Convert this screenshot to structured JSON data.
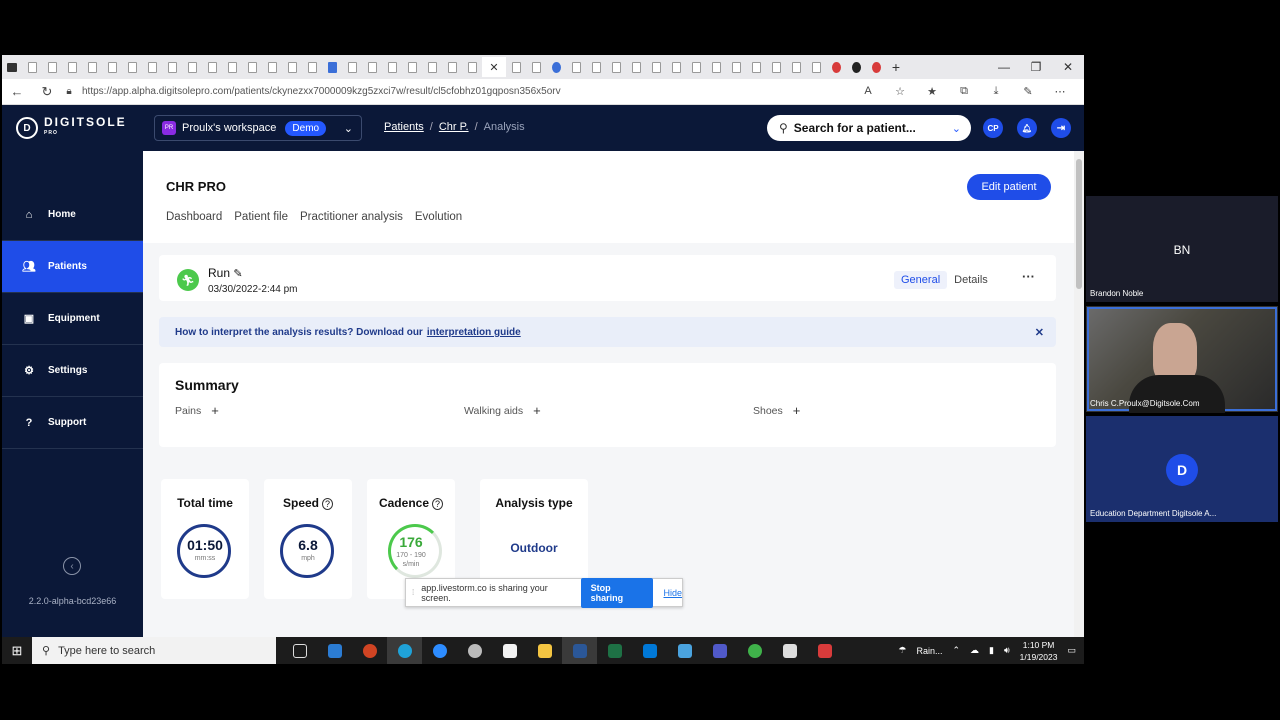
{
  "browser": {
    "url": "https://app.alpha.digitsolepro.com/patients/ckynezxx7000009kzg5zxci7w/result/cl5cfobhz01gqposn356x5orv"
  },
  "topnav": {
    "logo_text": "DIGITSOLE",
    "logo_sub": "PRO",
    "workspace_badge": "PR",
    "workspace_name": "Proulx's workspace",
    "workspace_tag": "Demo",
    "breadcrumbs": [
      "Patients",
      "Chr P.",
      "Analysis"
    ],
    "search_placeholder": "Search for a patient...",
    "user_initials": "CP"
  },
  "sidebar": {
    "items": [
      {
        "label": "Home",
        "icon": "home-icon"
      },
      {
        "label": "Patients",
        "icon": "patients-icon"
      },
      {
        "label": "Equipment",
        "icon": "equipment-icon"
      },
      {
        "label": "Settings",
        "icon": "gear-icon"
      },
      {
        "label": "Support",
        "icon": "help-icon"
      }
    ],
    "version": "2.2.0-alpha-bcd23e66"
  },
  "patient": {
    "name": "CHR PRO",
    "edit_label": "Edit patient",
    "tabs": [
      "Dashboard",
      "Patient file",
      "Practitioner analysis",
      "Evolution"
    ]
  },
  "session": {
    "title": "Run",
    "date": "03/30/2022-2:44 pm",
    "view_general": "General",
    "view_details": "Details"
  },
  "banner": {
    "text": "How to interpret the analysis results? Download our",
    "link": "interpretation guide"
  },
  "summary": {
    "title": "Summary",
    "fields": [
      "Pains",
      "Walking aids",
      "Shoes"
    ]
  },
  "metrics": {
    "total_time": {
      "label": "Total time",
      "value": "01:50",
      "unit": "mm:ss"
    },
    "speed": {
      "label": "Speed",
      "value": "6.8",
      "unit": "mph"
    },
    "cadence": {
      "label": "Cadence",
      "value": "176",
      "range": "170 - 190",
      "unit": "s/min"
    },
    "analysis_type": {
      "label": "Analysis type",
      "value": "Outdoor"
    }
  },
  "share_bar": {
    "message": "app.livestorm.co is sharing your screen.",
    "stop_label": "Stop sharing",
    "hide_label": "Hide"
  },
  "taskbar": {
    "search_placeholder": "Type here to search",
    "weather": "Rain...",
    "time": "1:10 PM",
    "date": "1/19/2023"
  },
  "video": {
    "participant1_initials": "BN",
    "participant1_name": "Brandon Noble",
    "participant2_name": "Chris C.Proulx@Digitsole.Com",
    "participant3_name": "Education Department Digitsole A..."
  },
  "colors": {
    "nav_bg": "#0b1838",
    "accent": "#1f4de8",
    "run_green": "#4cc94c"
  }
}
